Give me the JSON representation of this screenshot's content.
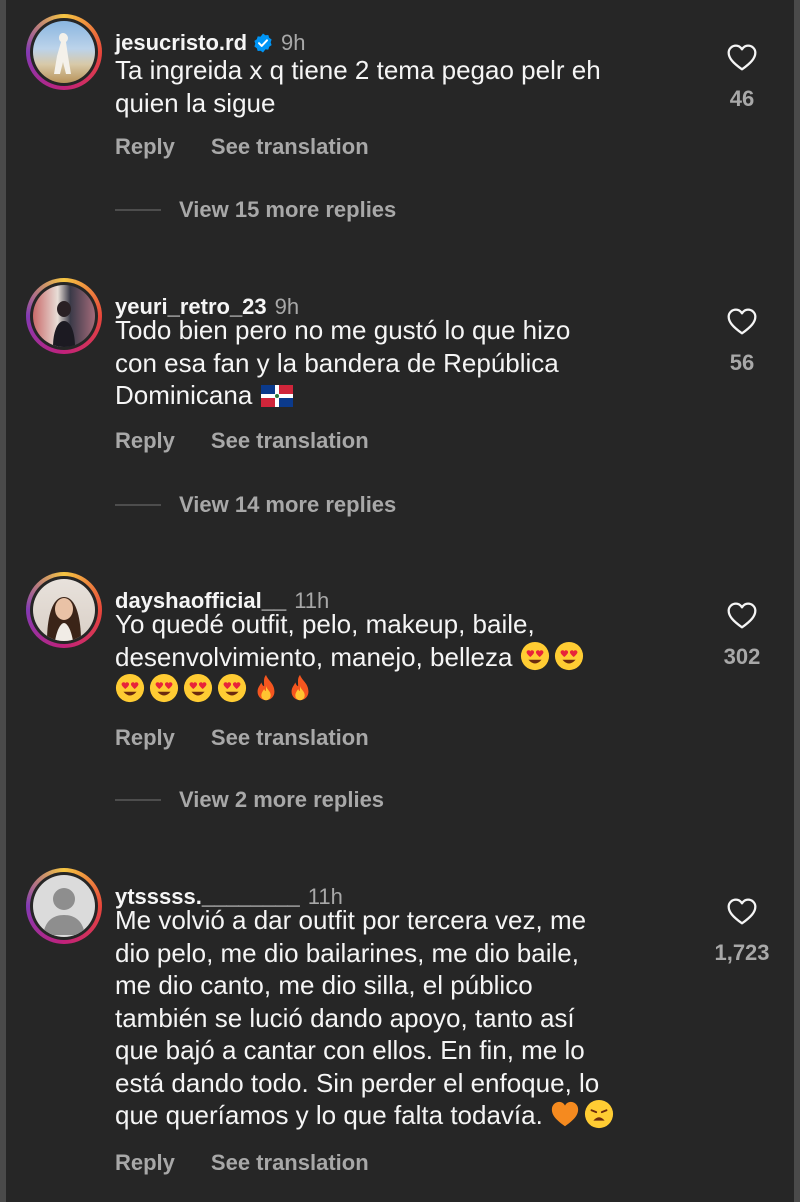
{
  "comments": [
    {
      "username": "jesucristo.rd",
      "verified": true,
      "time": "9h",
      "text_lines": [
        "Ta ingreida x q tiene 2 tema pegao pelr eh",
        "quien la sigue"
      ],
      "reply_label": "Reply",
      "translate_label": "See translation",
      "view_replies": "View 15 more replies",
      "likes": "46"
    },
    {
      "username": "yeuri_retro_23",
      "verified": false,
      "time": "9h",
      "text_lines": [
        "Todo bien pero no me gustó lo que hizo",
        "con esa fan y la bandera de República",
        "Dominicana"
      ],
      "reply_label": "Reply",
      "translate_label": "See translation",
      "view_replies": "View 14 more replies",
      "likes": "56"
    },
    {
      "username": "dayshaofficial__",
      "verified": false,
      "time": "11h",
      "text_lines": [
        "Yo quedé outfit, pelo, makeup, baile,",
        "desenvolvimiento, manejo, belleza"
      ],
      "reply_label": "Reply",
      "translate_label": "See translation",
      "view_replies": "View 2 more replies",
      "likes": "302"
    },
    {
      "username": "ytsssss.________",
      "verified": false,
      "time": "11h",
      "text_lines": [
        "Me volvió a dar outfit por tercera vez, me",
        "dio pelo, me dio bailarines, me dio baile,",
        "me dio canto, me dio silla, el público",
        "también se lució dando apoyo, tanto así",
        "que bajó a cantar con ellos. En fin, me lo",
        "está dando todo. Sin perder el enfoque, lo",
        "que queríamos y lo que falta todavía."
      ],
      "reply_label": "Reply",
      "translate_label": "See translation",
      "likes": "1,723"
    }
  ],
  "icons": {
    "like": "heart-outline-icon",
    "verified": "verified-badge-icon",
    "flag": "dominican-flag-emoji",
    "heart_eyes": "smiling-face-with-heart-eyes-emoji",
    "fire": "fire-emoji",
    "orange_heart": "orange-heart-emoji",
    "weary": "weary-face-emoji"
  },
  "colors": {
    "background": "#262626",
    "primary_text": "#f5f5f5",
    "secondary_text": "#a8a8a8",
    "verified_blue": "#0095f6"
  }
}
